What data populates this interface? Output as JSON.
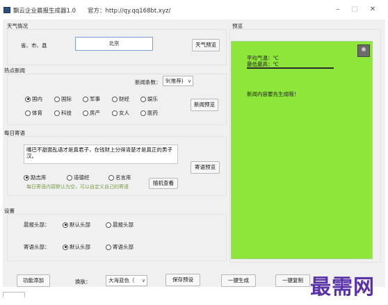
{
  "window": {
    "title": "飘云企业晨报生成器1.0　　官方：http://qy.qq168bt.xyz/",
    "min_icon": "minimize-icon",
    "max_icon": "maximize-icon",
    "close_icon": "close-icon"
  },
  "weather": {
    "group_label": "天气情况",
    "location_label": "省、市、县",
    "location_value": "北京",
    "preview_button": "天气预览"
  },
  "news": {
    "group_label": "热点新闻",
    "count_label": "新闻条数：",
    "count_value": "9(推荐)",
    "categories": [
      {
        "label": "国内",
        "checked": true
      },
      {
        "label": "国际",
        "checked": false
      },
      {
        "label": "军事",
        "checked": false
      },
      {
        "label": "财经",
        "checked": false
      },
      {
        "label": "娱乐",
        "checked": false
      },
      {
        "label": "体育",
        "checked": false
      },
      {
        "label": "科技",
        "checked": false
      },
      {
        "label": "房产",
        "checked": false
      },
      {
        "label": "女人",
        "checked": false
      },
      {
        "label": "医药",
        "checked": false
      }
    ],
    "preview_button": "新闻预览"
  },
  "quote": {
    "group_label": "每日寄语",
    "text": "嘴巴不甜面乱语才是真君子，在钱财上分得清楚才是真正的男子汉。",
    "options": [
      {
        "label": "励志库",
        "checked": true
      },
      {
        "label": "道德经",
        "checked": false
      },
      {
        "label": "名言库",
        "checked": false
      }
    ],
    "hint": "每日寄语内容默认为空，可以自定义自己的寄语",
    "random_button": "随机查看",
    "preview_button": "寄语预览"
  },
  "settings": {
    "group_label": "设置",
    "morning_header_label": "晨报头部：",
    "morning_header_options": [
      {
        "label": "默认头部",
        "checked": true
      },
      {
        "label": "晨报头部",
        "checked": false
      }
    ],
    "quote_header_label": "寄语头部：",
    "quote_header_options": [
      {
        "label": "默认头部",
        "checked": true
      },
      {
        "label": "寄语头部",
        "checked": false
      }
    ]
  },
  "preview": {
    "group_label": "预览",
    "avg_temp": "平均气温：℃",
    "min_temp": "最低最高：℃",
    "news_status": "新闻内容要先生成哦！",
    "background_color": "#8fe63b"
  },
  "toolbar": {
    "add_button": "功能添加",
    "skin_label": "换肤：",
    "skin_value": "大海蓝色（",
    "save_button": "保存预设",
    "generate_button": "一键生成",
    "copy_button": "一键复制"
  },
  "watermark": {
    "text": "最需网"
  }
}
